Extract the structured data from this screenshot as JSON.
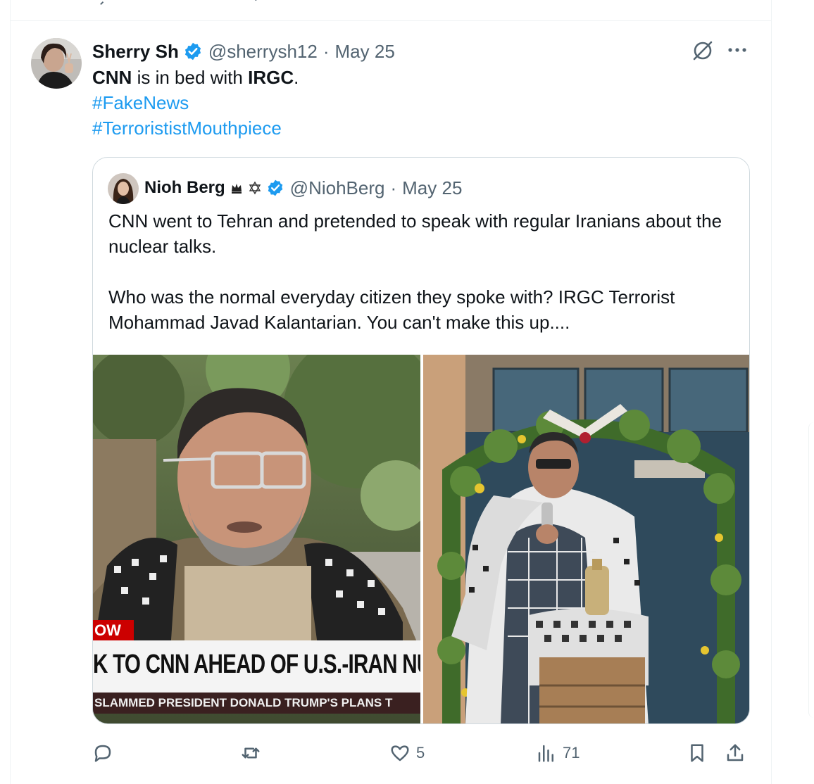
{
  "tweet": {
    "author": {
      "display_name": "Sherry Sh",
      "handle": "@sherrysh12",
      "date": "May 25",
      "separator": "·"
    },
    "text_parts": {
      "cnn": "CNN",
      "middle": " is in bed with ",
      "irgc": "IRGC",
      "end": "."
    },
    "hashtags": [
      "#FakeNews",
      "#TerrorististMouthpiece"
    ],
    "quoted": {
      "display_name": "Nioh Berg",
      "handle": "@NiohBerg",
      "date": "May 25",
      "separator": "·",
      "paragraphs": [
        "CNN went to Tehran and pretended to speak with regular Iranians about the nuclear talks.",
        "Who was the normal everyday citizen they spoke with? IRGC Terrorist Mohammad Javad Kalantarian. You can't make this up...."
      ],
      "media": {
        "chyron_tag": "OW",
        "chyron_headline": "K TO CNN AHEAD OF U.S.-IRAN NUCLEAR",
        "chyron_sub": "SLAMMED PRESIDENT DONALD TRUMP'S PLANS T"
      }
    },
    "metrics": {
      "replies": "",
      "reposts": "",
      "likes": "5",
      "views": "71"
    }
  },
  "colors": {
    "accent": "#1d9bf0",
    "muted": "#536471",
    "border": "#cfd9de",
    "cnn_red": "#cc0000"
  },
  "icons": {
    "reply": "reply-icon",
    "repost": "repost-icon",
    "like": "heart-icon",
    "views": "views-icon",
    "bookmark": "bookmark-icon",
    "share": "share-icon",
    "grok": "grok-icon",
    "more": "more-icon",
    "verified": "verified-icon"
  }
}
